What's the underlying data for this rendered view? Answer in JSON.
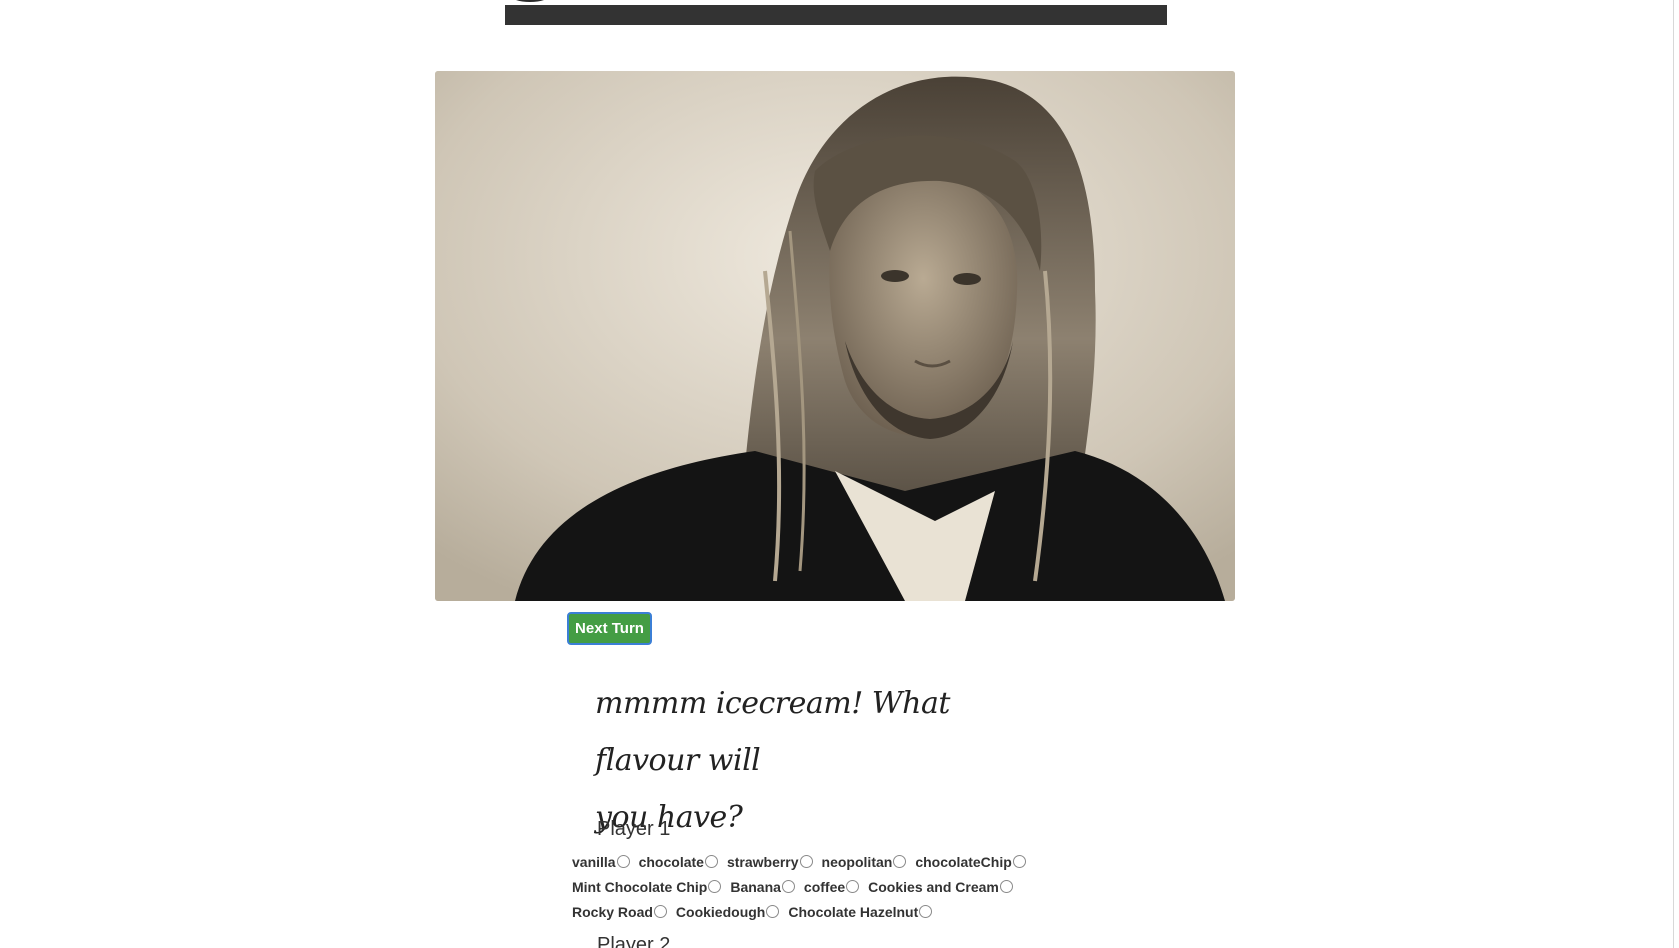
{
  "header": {
    "bar_color": "#333333"
  },
  "hero": {
    "image": "man-with-long-hair-portrait-sepia"
  },
  "actions": {
    "next_turn_label": "Next Turn",
    "next_turn_color": "#449d44"
  },
  "prompt": {
    "line1": "mmmm icecream! What flavour will",
    "line2": "you have?"
  },
  "players": [
    {
      "name": "Player 1",
      "flavour_rows": [
        [
          "vanilla",
          "chocolate",
          "strawberry",
          "neopolitan",
          "chocolateChip"
        ],
        [
          "Mint Chocolate Chip",
          "Banana",
          "coffee",
          "Cookies and Cream"
        ],
        [
          "Rocky Road",
          "Cookiedough",
          "Chocolate Hazelnut"
        ]
      ]
    },
    {
      "name": "Player 2"
    }
  ]
}
